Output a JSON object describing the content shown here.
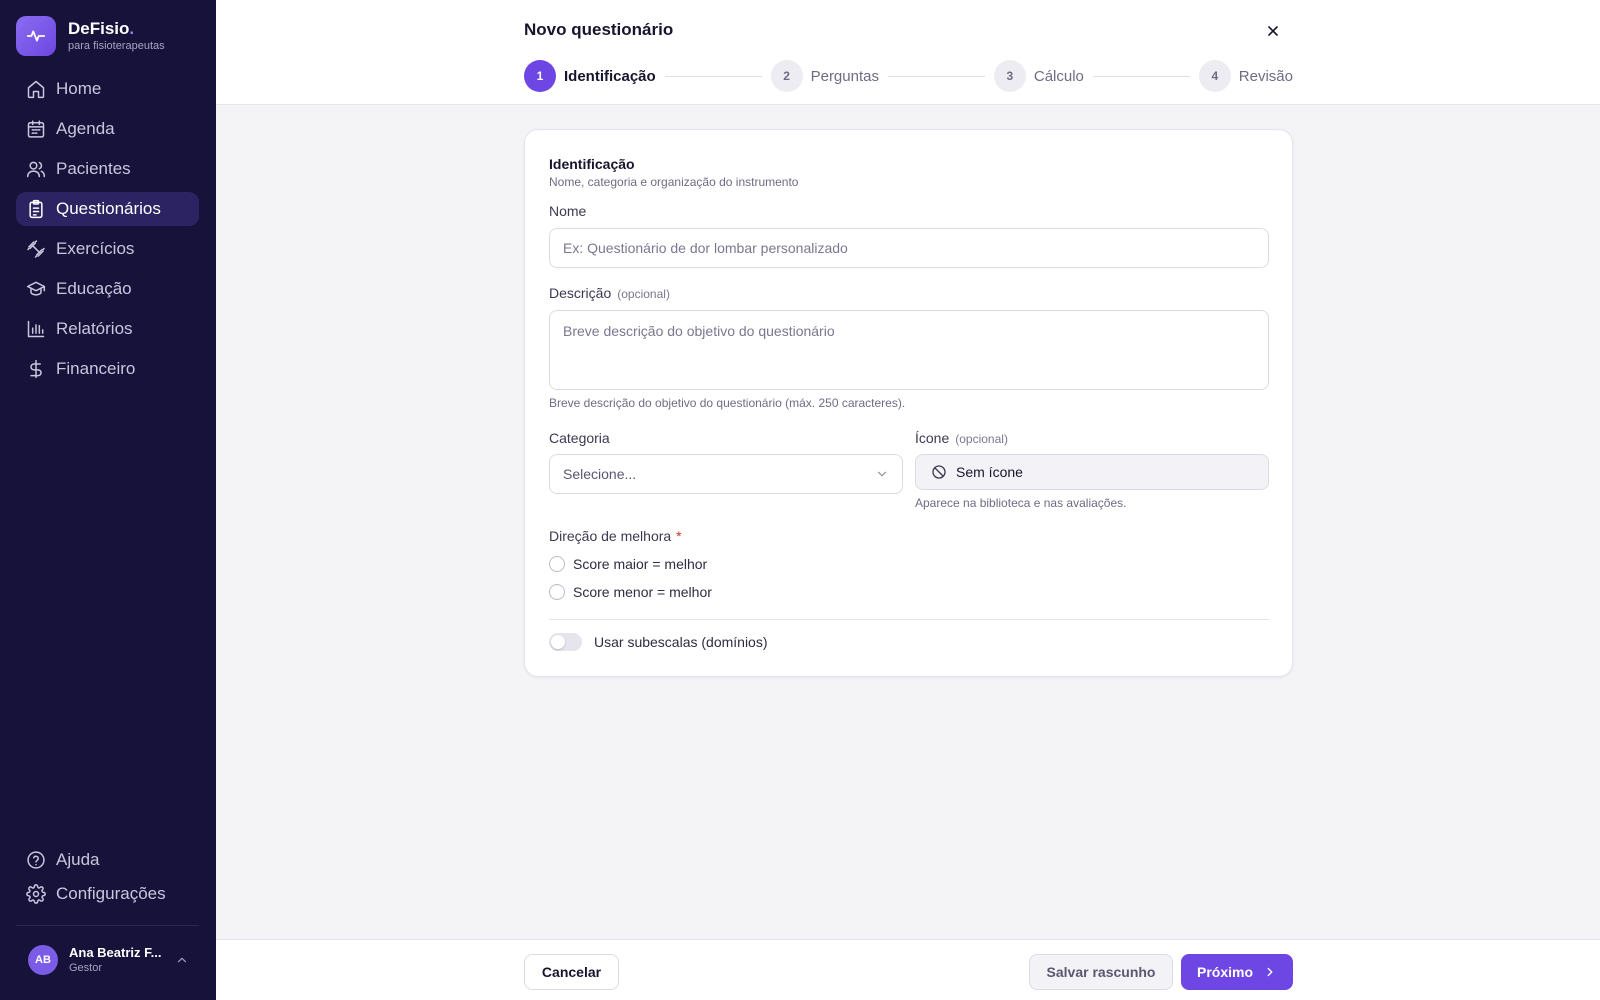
{
  "brand": {
    "name": "DeFisio",
    "dot": ".",
    "subtitle": "para fisioterapeutas"
  },
  "sidebar": {
    "items": [
      {
        "label": "Home",
        "icon": "home-icon"
      },
      {
        "label": "Agenda",
        "icon": "calendar-icon"
      },
      {
        "label": "Pacientes",
        "icon": "users-icon"
      },
      {
        "label": "Questionários",
        "icon": "clipboard-icon",
        "active": true
      },
      {
        "label": "Exercícios",
        "icon": "dumbbell-icon"
      },
      {
        "label": "Educação",
        "icon": "graduation-cap-icon"
      },
      {
        "label": "Relatórios",
        "icon": "bar-chart-icon"
      },
      {
        "label": "Financeiro",
        "icon": "dollar-icon"
      }
    ],
    "bottom_items": [
      {
        "label": "Ajuda",
        "icon": "help-circle-icon"
      },
      {
        "label": "Configurações",
        "icon": "settings-icon"
      }
    ]
  },
  "user": {
    "initials": "AB",
    "name": "Ana Beatriz F...",
    "role": "Gestor"
  },
  "header": {
    "title": "Novo questionário",
    "steps": [
      {
        "number": "1",
        "label": "Identificação",
        "active": true
      },
      {
        "number": "2",
        "label": "Perguntas",
        "active": false
      },
      {
        "number": "3",
        "label": "Cálculo",
        "active": false
      },
      {
        "number": "4",
        "label": "Revisão",
        "active": false
      }
    ]
  },
  "form": {
    "section_title": "Identificação",
    "section_subtitle": "Nome, categoria e organização do instrumento",
    "name": {
      "label": "Nome",
      "placeholder": "Ex: Questionário de dor lombar personalizado",
      "value": ""
    },
    "description": {
      "label": "Descrição",
      "optional": "(opcional)",
      "placeholder": "Breve descrição do objetivo do questionário",
      "hint": "Breve descrição do objetivo do questionário (máx. 250 caracteres).",
      "value": ""
    },
    "category": {
      "label": "Categoria",
      "selected": "Selecione..."
    },
    "icon": {
      "label": "Ícone",
      "optional": "(opcional)",
      "value": "Sem ícone",
      "hint": "Aparece na biblioteca e nas avaliações."
    },
    "direction": {
      "label": "Direção de melhora",
      "required_mark": "*",
      "options": [
        "Score maior = melhor",
        "Score menor = melhor"
      ]
    },
    "subscales": {
      "label": "Usar subescalas (domínios)",
      "enabled": false
    }
  },
  "footer": {
    "cancel": "Cancelar",
    "save_draft": "Salvar rascunho",
    "next": "Próximo"
  },
  "colors": {
    "sidebar_bg": "#16123a",
    "accent": "#6d46e3",
    "active_nav": "#2c2363",
    "required": "#d92d20"
  }
}
